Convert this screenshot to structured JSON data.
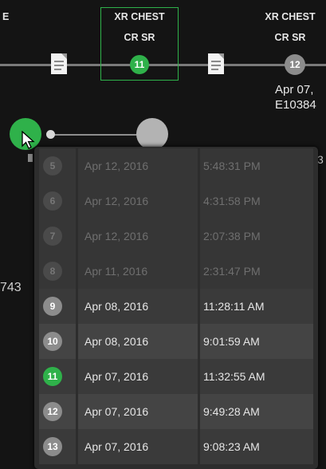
{
  "timeline": {
    "left_label": "E",
    "studies": [
      {
        "line1": "XR CHEST",
        "line2": "CR SR",
        "number": "11",
        "selected": true
      },
      {
        "line1": "XR CHEST",
        "line2": "CR SR",
        "number": "12",
        "date": "Apr 07,",
        "id": "E10384"
      }
    ],
    "left_value": "743",
    "right_digit": "3"
  },
  "colors": {
    "accent_green": "#2fb14a",
    "background": "#141414",
    "popup": "#2d2d2d"
  },
  "list": {
    "rows": [
      {
        "num": "5",
        "date": "Apr 12, 2016",
        "time": "5:48:31 PM",
        "state": "dim"
      },
      {
        "num": "6",
        "date": "Apr 12, 2016",
        "time": "4:31:58 PM",
        "state": "dim"
      },
      {
        "num": "7",
        "date": "Apr 12, 2016",
        "time": "2:07:38 PM",
        "state": "dim"
      },
      {
        "num": "8",
        "date": "Apr 11, 2016",
        "time": "2:31:47 PM",
        "state": "dim"
      },
      {
        "num": "9",
        "date": "Apr 08, 2016",
        "time": "11:28:11 AM",
        "state": "bright"
      },
      {
        "num": "10",
        "date": "Apr 08, 2016",
        "time": "9:01:59 AM",
        "state": "bright"
      },
      {
        "num": "11",
        "date": "Apr 07, 2016",
        "time": "11:32:55 AM",
        "state": "selected"
      },
      {
        "num": "12",
        "date": "Apr 07, 2016",
        "time": "9:49:28 AM",
        "state": "bright"
      },
      {
        "num": "13",
        "date": "Apr 07, 2016",
        "time": "9:08:23 AM",
        "state": "bright"
      }
    ]
  }
}
